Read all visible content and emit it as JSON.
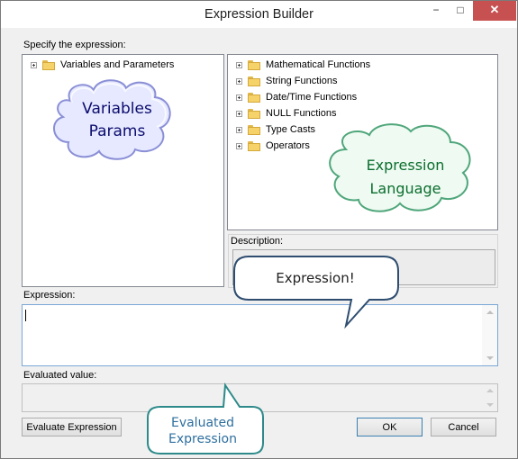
{
  "window": {
    "title": "Expression Builder",
    "minimize": "−",
    "maximize": "□",
    "close": "✕"
  },
  "labels": {
    "specify": "Specify the expression:",
    "description": "Description:",
    "expression": "Expression:",
    "evaluated": "Evaluated value:"
  },
  "left_tree": {
    "items": [
      {
        "label": "Variables and Parameters",
        "icon": "folder-icon"
      }
    ]
  },
  "right_tree": {
    "items": [
      {
        "label": "Mathematical Functions",
        "icon": "folder-icon"
      },
      {
        "label": "String Functions",
        "icon": "folder-icon"
      },
      {
        "label": "Date/Time Functions",
        "icon": "folder-icon"
      },
      {
        "label": "NULL Functions",
        "icon": "folder-icon"
      },
      {
        "label": "Type Casts",
        "icon": "folder-icon"
      },
      {
        "label": "Operators",
        "icon": "folder-icon"
      }
    ]
  },
  "expression": {
    "value": ""
  },
  "evaluated": {
    "value": ""
  },
  "buttons": {
    "evaluate": "Evaluate Expression",
    "ok": "OK",
    "cancel": "Cancel"
  },
  "callouts": {
    "variables_line1": "Variables",
    "variables_line2": "Params",
    "expression_language_line1": "Expression",
    "expression_language_line2": "Language",
    "expression": "Expression!",
    "evaluated_line1": "Evaluated",
    "evaluated_line2": "Expression"
  },
  "colors": {
    "cloud_blue_fill": "#e6e9ff",
    "cloud_blue_stroke": "#8a8fd6",
    "cloud_green_fill": "#eefaf2",
    "cloud_green_stroke": "#4fa67a",
    "callout_stroke": "#2e4d70",
    "callout_green_stroke": "#2e8a8a"
  }
}
